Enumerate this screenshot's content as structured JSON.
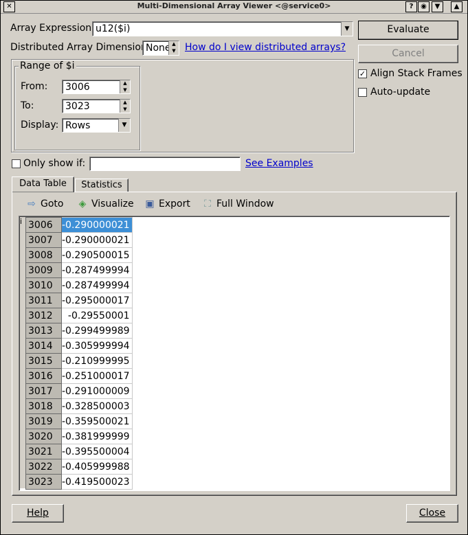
{
  "window": {
    "title": "Multi-Dimensional Array Viewer <@service0>"
  },
  "array_expression": {
    "label": "Array Expression:",
    "value": "u12($i)"
  },
  "distributed": {
    "label": "Distributed Array Dimensions:",
    "value": "None",
    "help_link": "How do I view distributed arrays?"
  },
  "buttons": {
    "evaluate": "Evaluate",
    "cancel": "Cancel",
    "help": "Help",
    "close": "Close"
  },
  "options": {
    "align_stack_frames": "Align Stack Frames",
    "align_checked": true,
    "auto_update": "Auto-update",
    "auto_update_checked": false
  },
  "range": {
    "legend": "Range of $i",
    "from_label": "From:",
    "from_value": "3006",
    "to_label": "To:",
    "to_value": "3023",
    "display_label": "Display:",
    "display_value": "Rows"
  },
  "filter": {
    "label": "Only show if:",
    "value": "",
    "examples_link": "See Examples"
  },
  "tabs": [
    "Data Table",
    "Statistics"
  ],
  "toolbar": {
    "goto": "Goto",
    "visualize": "Visualize",
    "export": "Export",
    "full_window": "Full Window"
  },
  "table": {
    "header_corner": "i",
    "rows": [
      {
        "index": "3006",
        "value": "-0.290000021"
      },
      {
        "index": "3007",
        "value": "-0.290000021"
      },
      {
        "index": "3008",
        "value": "-0.290500015"
      },
      {
        "index": "3009",
        "value": "-0.287499994"
      },
      {
        "index": "3010",
        "value": "-0.287499994"
      },
      {
        "index": "3011",
        "value": "-0.295000017"
      },
      {
        "index": "3012",
        "value": "-0.29550001"
      },
      {
        "index": "3013",
        "value": "-0.299499989"
      },
      {
        "index": "3014",
        "value": "-0.305999994"
      },
      {
        "index": "3015",
        "value": "-0.210999995"
      },
      {
        "index": "3016",
        "value": "-0.251000017"
      },
      {
        "index": "3017",
        "value": "-0.291000009"
      },
      {
        "index": "3018",
        "value": "-0.328500003"
      },
      {
        "index": "3019",
        "value": "-0.359500021"
      },
      {
        "index": "3020",
        "value": "-0.381999999"
      },
      {
        "index": "3021",
        "value": "-0.395500004"
      },
      {
        "index": "3022",
        "value": "-0.405999988"
      },
      {
        "index": "3023",
        "value": "-0.419500023"
      }
    ]
  },
  "colors": {
    "selection": "#3d8fd6",
    "link": "#0000cc",
    "background": "#d4d0c8"
  }
}
